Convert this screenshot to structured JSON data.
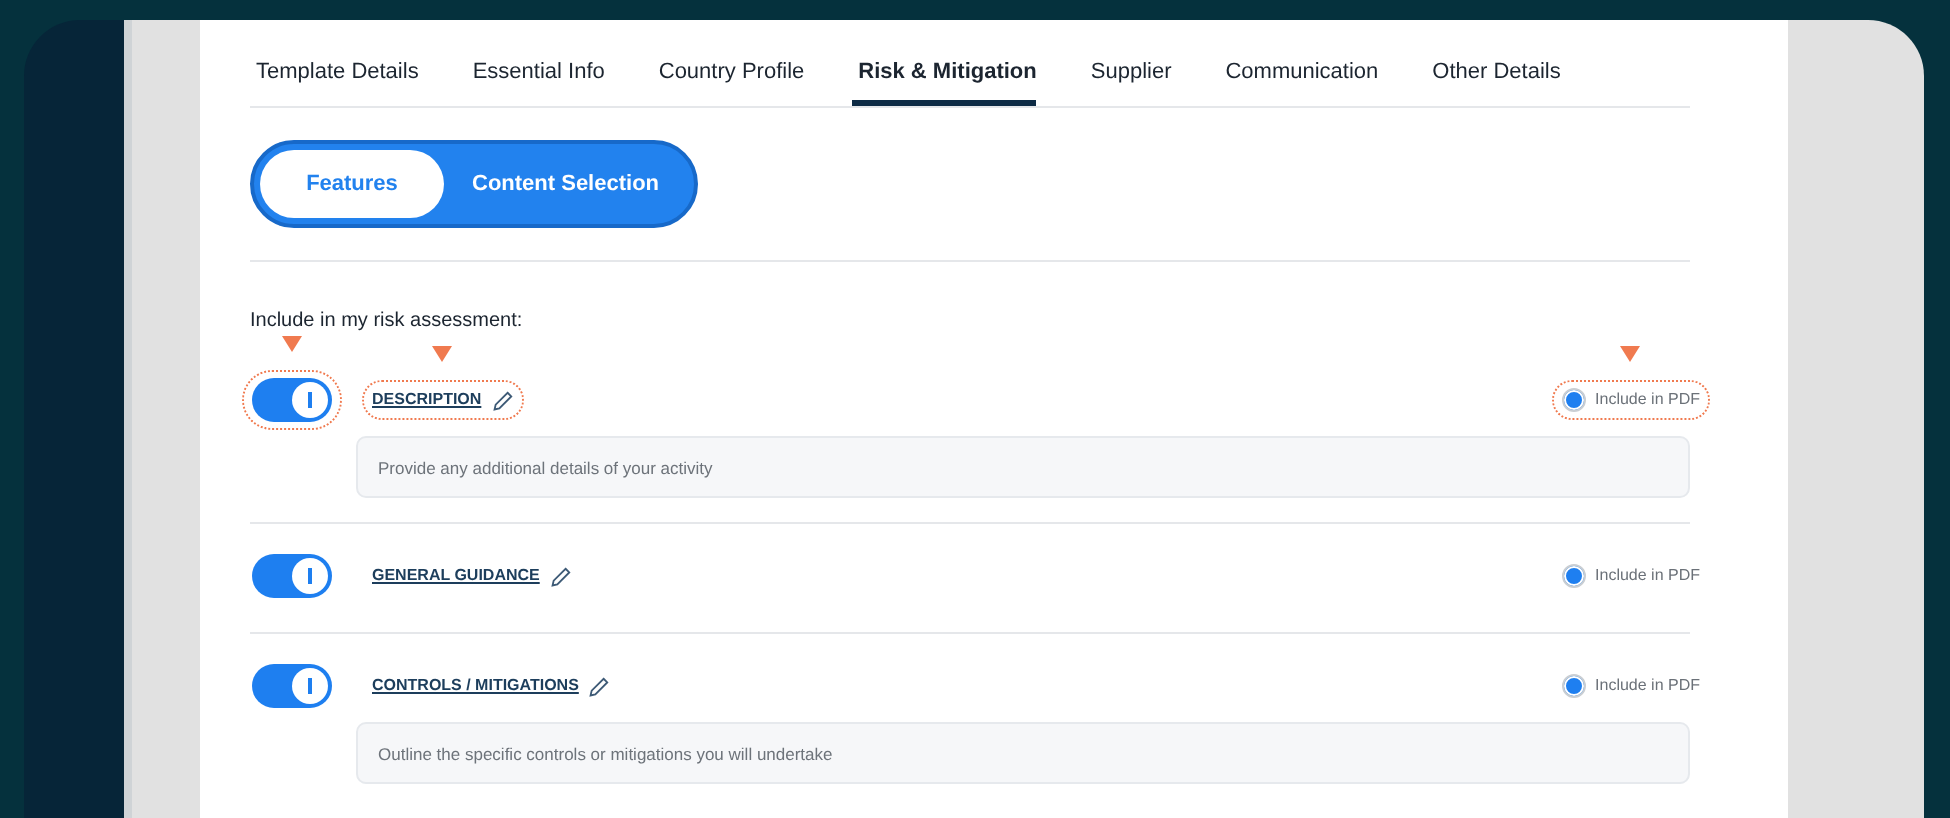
{
  "tabs": [
    {
      "label": "Template Details",
      "selected": false
    },
    {
      "label": "Essential Info",
      "selected": false
    },
    {
      "label": "Country Profile",
      "selected": false
    },
    {
      "label": "Risk & Mitigation",
      "selected": true
    },
    {
      "label": "Supplier",
      "selected": false
    },
    {
      "label": "Communication",
      "selected": false
    },
    {
      "label": "Other Details",
      "selected": false
    }
  ],
  "segments": [
    {
      "label": "Features",
      "selected": true
    },
    {
      "label": "Content Selection",
      "selected": false
    }
  ],
  "intro": "Include in my risk assessment:",
  "features": [
    {
      "title": "DESCRIPTION",
      "enabled": true,
      "highlighted": true,
      "pdf_label": "Include in PDF",
      "include_pdf": true,
      "placeholder": "Provide any additional details of your activity"
    },
    {
      "title": "GENERAL GUIDANCE",
      "enabled": true,
      "highlighted": false,
      "pdf_label": "Include in PDF",
      "include_pdf": true
    },
    {
      "title": "CONTROLS / MITIGATIONS",
      "enabled": true,
      "highlighted": false,
      "pdf_label": "Include in PDF",
      "include_pdf": true,
      "placeholder": "Outline the specific controls or mitigations you will undertake"
    }
  ]
}
